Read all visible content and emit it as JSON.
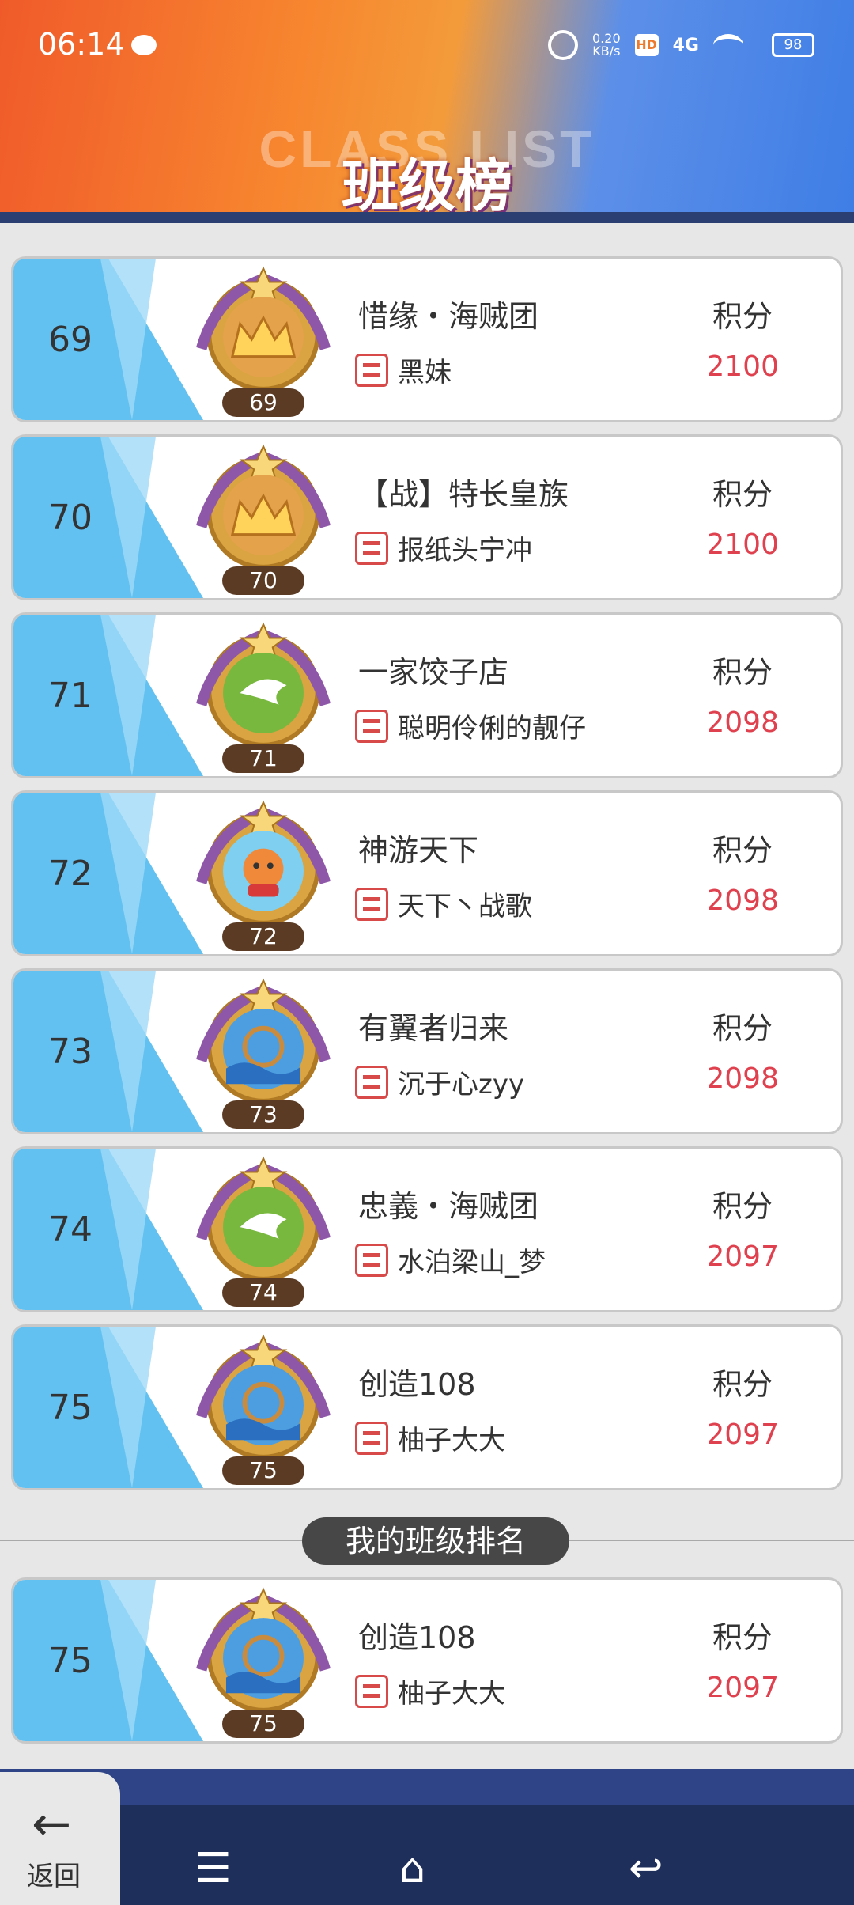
{
  "status_bar": {
    "time": "06:14",
    "net_speed_value": "0.20",
    "net_speed_unit": "KB/s",
    "hd": "HD",
    "signal": "4G",
    "battery": "98"
  },
  "header": {
    "title_en": "CLASS LIST",
    "title_cn": "班级榜"
  },
  "score_label": "积分",
  "rows": [
    {
      "rank": "69",
      "level": "69",
      "badge": "crown",
      "class_name": "惜缘・海贼团",
      "leader": "黑妹",
      "score": "2100"
    },
    {
      "rank": "70",
      "level": "70",
      "badge": "crown",
      "class_name": "【战】特长皇族",
      "leader": "报纸头宁冲",
      "score": "2100"
    },
    {
      "rank": "71",
      "level": "71",
      "badge": "dove",
      "class_name": "一家饺子店",
      "leader": "聪明伶俐的靓仔",
      "score": "2098"
    },
    {
      "rank": "72",
      "level": "72",
      "badge": "mascot",
      "class_name": "神游天下",
      "leader": "天下丶战歌",
      "score": "2098"
    },
    {
      "rank": "73",
      "level": "73",
      "badge": "helm",
      "class_name": "有翼者归来",
      "leader": "沉于心zyy",
      "score": "2098"
    },
    {
      "rank": "74",
      "level": "74",
      "badge": "dove",
      "class_name": "忠義・海贼团",
      "leader": "水泊梁山_梦",
      "score": "2097"
    },
    {
      "rank": "75",
      "level": "75",
      "badge": "helm",
      "class_name": "创造108",
      "leader": "柚子大大",
      "score": "2097"
    }
  ],
  "my_rank": {
    "title": "我的班级排名",
    "rank": "75",
    "level": "75",
    "badge": "helm",
    "class_name": "创造108",
    "leader": "柚子大大",
    "score": "2097"
  },
  "back_label": "返回",
  "nav": {
    "menu_icon": "menu-icon",
    "home_icon": "home-icon",
    "back_icon": "back-icon"
  }
}
